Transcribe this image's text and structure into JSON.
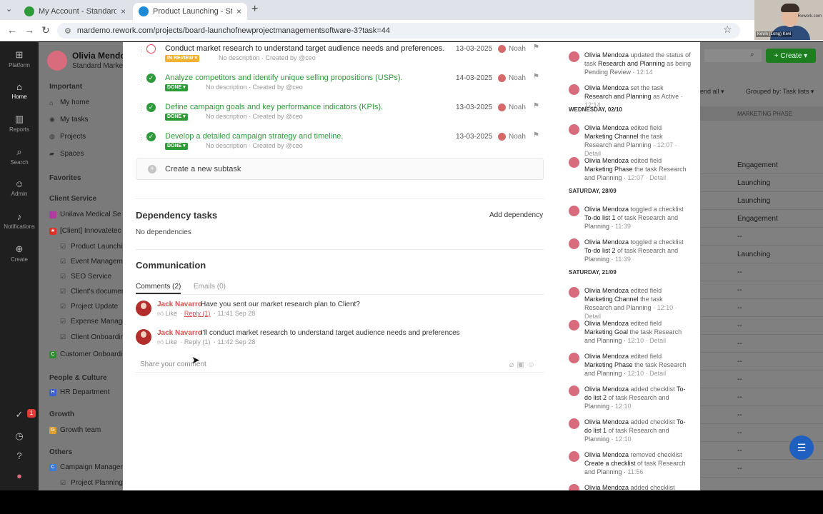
{
  "browser": {
    "tabs": [
      {
        "title": "My Account - Standard Market",
        "active": false
      },
      {
        "title": "Product Launching - Standard M",
        "active": true
      }
    ],
    "url": "mardemo.rework.com/projects/board-launchofnewprojectmanagementsoftware-3?task=44"
  },
  "webcam": {
    "name": "Kevin (Long) Kevi",
    "brand": "Rework.com"
  },
  "rail": [
    {
      "label": "Platform",
      "icon": "grid-icon"
    },
    {
      "label": "Home",
      "icon": "home-icon",
      "active": true
    },
    {
      "label": "Reports",
      "icon": "chart-icon"
    },
    {
      "label": "Search",
      "icon": "search-icon"
    },
    {
      "label": "Admin",
      "icon": "person-icon"
    },
    {
      "label": "Notifications",
      "icon": "bell-icon"
    },
    {
      "label": "Create",
      "icon": "plus-icon"
    }
  ],
  "rail_badge": "1",
  "sidebar": {
    "user_name": "Olivia Mendoza",
    "company": "Standard Market",
    "important_label": "Important",
    "important": [
      "My home",
      "My tasks",
      "Projects",
      "Spaces"
    ],
    "favorites_label": "Favorites",
    "client_service_label": "Client Service",
    "client_service": [
      {
        "label": "Unilava Medical Se",
        "color": "#b23aa0"
      },
      {
        "label": "[Client] Innovatetec",
        "color": "#d9342b"
      }
    ],
    "client_sub": [
      "Product Launching",
      "Event Managemen",
      "SEO Service",
      "Client's document",
      "Project Update",
      "Expense Managem",
      "Client Onboarding"
    ],
    "customer_onboarding": {
      "label": "Customer Onboardin",
      "color": "#2e8b2e",
      "letter": "C"
    },
    "people_label": "People & Culture",
    "hr": {
      "label": "HR Department",
      "color": "#3a5fcf",
      "letter": "H"
    },
    "growth_label": "Growth",
    "growth_team": {
      "label": "Growth team",
      "color": "#e0a030",
      "letter": "G"
    },
    "others_label": "Others",
    "campaign": {
      "label": "Campaign Managem",
      "color": "#3a7bd5",
      "letter": "C"
    },
    "project_planning": "Project Planning"
  },
  "board": {
    "create_label": "Create",
    "endall_label": "end all",
    "grouped_label": "Grouped by: Task lists",
    "column": "MARKETING PHASE",
    "cells": [
      "Engagement",
      "Launching",
      "Launching",
      "Engagement",
      "--",
      "Launching",
      "--",
      "--",
      "--",
      "--",
      "--",
      "--",
      "--",
      "--",
      "--",
      "--",
      "--",
      "--"
    ]
  },
  "subtasks": [
    {
      "title": "Conduct market research to understand target audience needs and preferences.",
      "status": "IN REVIEW",
      "done": false,
      "meta": "No description · Created by @ceo",
      "date": "13-03-2025",
      "assignee": "Noah"
    },
    {
      "title": "Analyze competitors and identify unique selling propositions (USPs).",
      "status": "DONE",
      "done": true,
      "meta": "No description · Created by @ceo",
      "date": "14-03-2025",
      "assignee": "Noah"
    },
    {
      "title": "Define campaign goals and key performance indicators (KPIs).",
      "status": "DONE",
      "done": true,
      "meta": "No description · Created by @ceo",
      "date": "13-03-2025",
      "assignee": "Noah"
    },
    {
      "title": "Develop a detailed campaign strategy and timeline.",
      "status": "DONE",
      "done": true,
      "meta": "No description · Created by @ceo",
      "date": "13-03-2025",
      "assignee": "Noah"
    }
  ],
  "create_subtask": "Create a new subtask",
  "dependency": {
    "title": "Dependency tasks",
    "add": "Add dependency",
    "empty": "No dependencies"
  },
  "communication": {
    "title": "Communication",
    "tabs": [
      "Comments (2)",
      "Emails (0)"
    ],
    "comments": [
      {
        "author": "Jack Navarro",
        "text": "Have you sent our market research plan to Client?",
        "like": "Like",
        "reply": "Reply (1)",
        "time": "11:41 Sep 28"
      },
      {
        "author": "Jack Navarro",
        "text": "I'll conduct market research to understand target audience needs and preferences",
        "like": "Like",
        "reply": "Reply (1)",
        "time": "11:42 Sep 28"
      }
    ],
    "placeholder": "Share your comment"
  },
  "activity": [
    {
      "type": "entry",
      "who": "Olivia Mendoza",
      "action": "updated the status of task",
      "task": "Research and Planning",
      "tail": "as being Pending Review",
      "time": "12:14",
      "lines": 3
    },
    {
      "type": "entry",
      "who": "Olivia Mendoza",
      "action": "set the task",
      "task": "Research and Planning",
      "tail": "as Active",
      "time": "12:14",
      "lines": 2
    },
    {
      "type": "date",
      "label": "WEDNESDAY, 02/10"
    },
    {
      "type": "entry",
      "who": "Olivia Mendoza",
      "action": "edited field",
      "task": "Marketing Channel",
      "tail": "the task Research and Planning",
      "time": "12:07 · Detail",
      "lines": 3
    },
    {
      "type": "entry",
      "who": "Olivia Mendoza",
      "action": "edited field",
      "task": "Marketing Phase",
      "tail": "the task Research and Planning",
      "time": "12:07 · Detail",
      "lines": 3
    },
    {
      "type": "date",
      "label": "SATURDAY, 28/09"
    },
    {
      "type": "entry",
      "who": "Olivia Mendoza",
      "action": "toggled a checklist",
      "task": "To-do list 1",
      "tail": "of task Research and Planning",
      "time": "11:39",
      "lines": 3
    },
    {
      "type": "entry",
      "who": "Olivia Mendoza",
      "action": "toggled a checklist",
      "task": "To-do list 2",
      "tail": "of task Research and Planning",
      "time": "11:39",
      "lines": 3
    },
    {
      "type": "date",
      "label": "SATURDAY, 21/09"
    },
    {
      "type": "entry",
      "who": "Olivia Mendoza",
      "action": "edited field",
      "task": "Marketing Channel",
      "tail": "the task Research and Planning",
      "time": "12:10 · Detail",
      "lines": 3
    },
    {
      "type": "entry",
      "who": "Olivia Mendoza",
      "action": "edited field",
      "task": "Marketing Goal",
      "tail": "the task Research and Planning",
      "time": "12:10 · Detail",
      "lines": 3
    },
    {
      "type": "entry",
      "who": "Olivia Mendoza",
      "action": "edited field",
      "task": "Marketing Phase",
      "tail": "the task Research and Planning",
      "time": "12:10 · Detail",
      "lines": 3
    },
    {
      "type": "entry",
      "who": "Olivia Mendoza",
      "action": "added checklist",
      "task": "To-do list 2",
      "tail": "of task Research and Planning",
      "time": "12:10",
      "lines": 3
    },
    {
      "type": "entry",
      "who": "Olivia Mendoza",
      "action": "added checklist",
      "task": "To-do list 1",
      "tail": "of task Research and Planning",
      "time": "12:10",
      "lines": 3
    },
    {
      "type": "entry",
      "who": "Olivia Mendoza",
      "action": "removed checklist",
      "task": "Create a checklist",
      "tail": "of task Research and Planning",
      "time": "11:56",
      "lines": 3
    },
    {
      "type": "entry",
      "who": "Olivia Mendoza",
      "action": "added checklist",
      "task": "",
      "tail": "",
      "time": "",
      "lines": 1
    }
  ],
  "colors": {
    "accent_green": "#2e9b3b",
    "review": "#f2b230",
    "author_red": "#d9534f",
    "chat_blue": "#1f5fbf"
  }
}
